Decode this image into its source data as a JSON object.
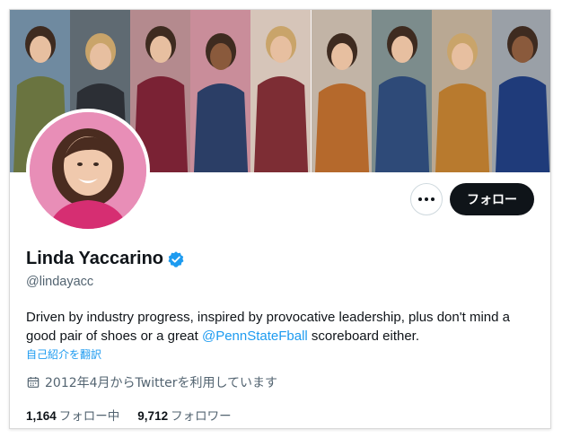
{
  "profile": {
    "name": "Linda Yaccarino",
    "handle": "@lindayacc",
    "bio_before": "Driven by industry progress, inspired by provocative leadership, plus don't mind a good pair of shoes or a great ",
    "bio_mention": "@PennStateFball",
    "bio_after": " scoreboard either.",
    "translate_label": "自己紹介を翻訳",
    "joined": "2012年4月からTwitterを利用しています",
    "following_count": "1,164",
    "following_label": "フォロー中",
    "followers_count": "9,712",
    "followers_label": "フォロワー"
  },
  "actions": {
    "follow_label": "フォロー",
    "more_icon": "more-icon"
  },
  "colors": {
    "accent": "#1d9bf0",
    "follow_button": "#0f1419",
    "secondary_text": "#536471",
    "avatar_background": "#e88eb7"
  },
  "banner": {
    "panels": [
      {
        "bg": "#6f8aa0",
        "outfit": "#6a7440"
      },
      {
        "bg": "#5f6a72",
        "outfit": "#2c2f35"
      },
      {
        "bg": "#b48a8e",
        "outfit": "#7a2234"
      },
      {
        "bg": "#c98d9a",
        "outfit": "#2b3e66"
      },
      {
        "bg": "#d6c5b9",
        "outfit": "#7d2d34"
      },
      {
        "bg": "#c2b4a6",
        "outfit": "#b5692c"
      },
      {
        "bg": "#7c8c8c",
        "outfit": "#2e4a78"
      },
      {
        "bg": "#b9a893",
        "outfit": "#b87a2e"
      },
      {
        "bg": "#9aa0a7",
        "outfit": "#1f3b7a"
      }
    ]
  }
}
